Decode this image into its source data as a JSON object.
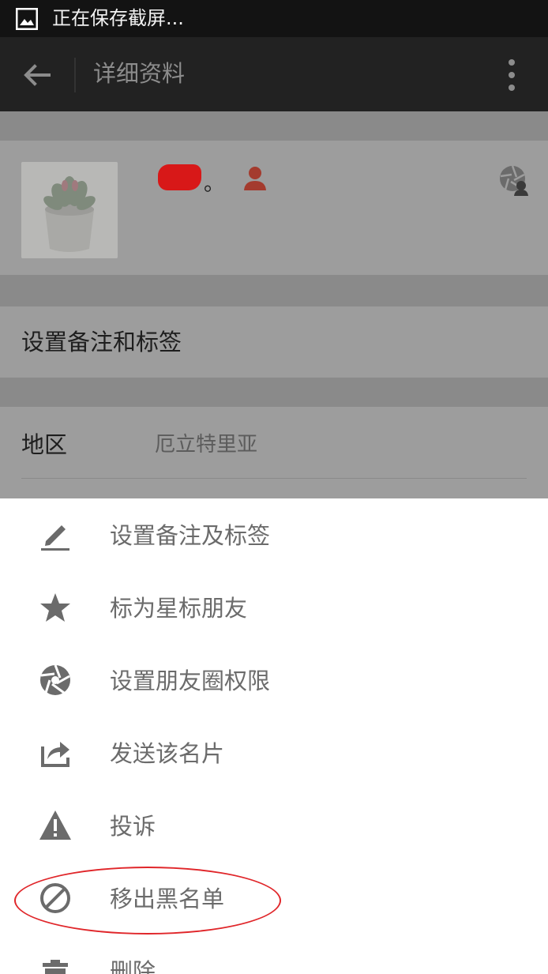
{
  "status_bar": {
    "text": "正在保存截屏..."
  },
  "action_bar": {
    "title": "详细资料"
  },
  "profile": {
    "name_suffix": "。"
  },
  "remark_row": {
    "label": "设置备注和标签"
  },
  "region_row": {
    "label": "地区",
    "value": "厄立特里亚"
  },
  "menu": {
    "items": [
      {
        "label": "设置备注及标签",
        "icon": "pencil-icon"
      },
      {
        "label": "标为星标朋友",
        "icon": "star-icon"
      },
      {
        "label": "设置朋友圈权限",
        "icon": "aperture-icon"
      },
      {
        "label": "发送该名片",
        "icon": "share-icon"
      },
      {
        "label": "投诉",
        "icon": "warning-icon"
      },
      {
        "label": "移出黑名单",
        "icon": "block-icon"
      },
      {
        "label": "删除",
        "icon": "trash-icon"
      }
    ]
  },
  "colors": {
    "highlight": "#e0262a",
    "redaction": "#d81818",
    "icon_gray": "#6b6b6b"
  }
}
